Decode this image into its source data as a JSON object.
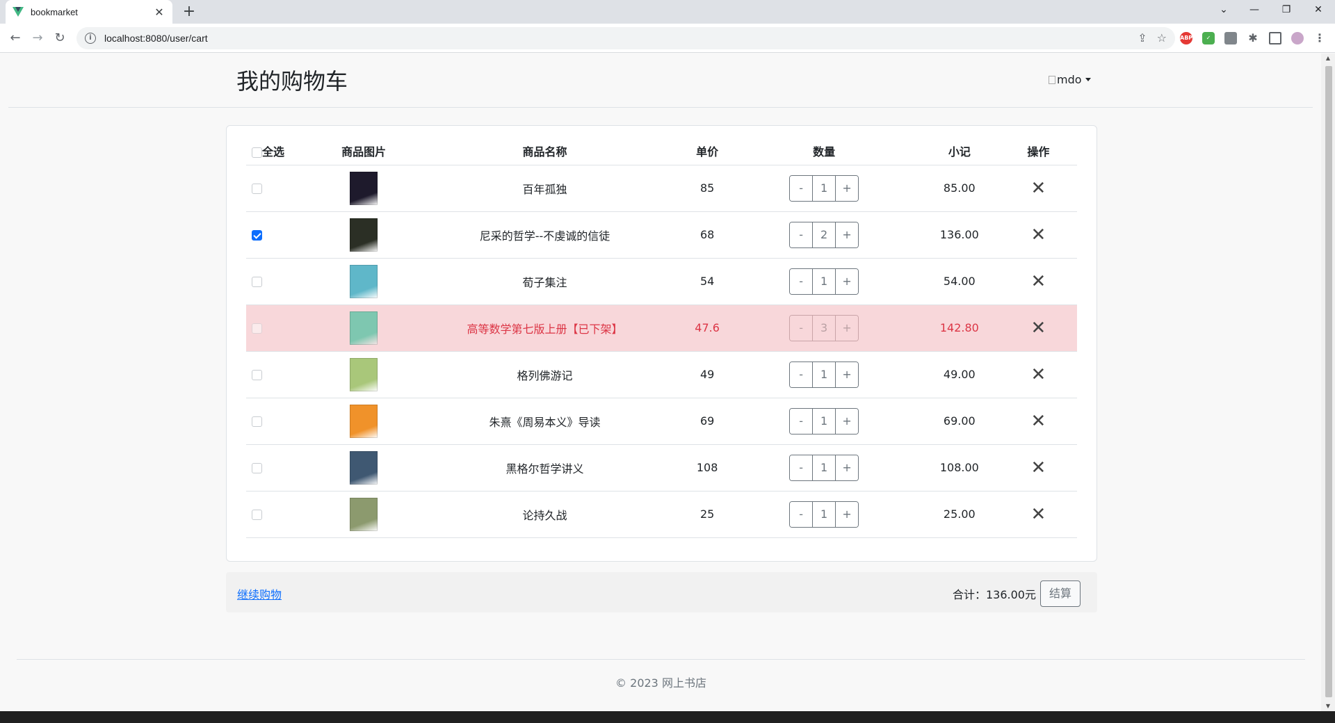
{
  "browser": {
    "tab_title": "bookmarket",
    "url": "localhost:8080/user/cart",
    "new_tab": "+",
    "tab_close": "✕"
  },
  "header": {
    "title": "我的购物车",
    "user_name": "mdo"
  },
  "table": {
    "headers": {
      "select_all": "全选",
      "image": "商品图片",
      "name": "商品名称",
      "price": "单价",
      "quantity": "数量",
      "subtotal": "小记",
      "action": "操作"
    },
    "rows": [
      {
        "checked": false,
        "disabled": false,
        "name": "百年孤独",
        "price": "85",
        "qty": "1",
        "subtotal": "85.00",
        "cover_color": "#1e1a2c"
      },
      {
        "checked": true,
        "disabled": false,
        "name": "尼采的哲学--不虔诚的信徒",
        "price": "68",
        "qty": "2",
        "subtotal": "136.00",
        "cover_color": "#2b2f25"
      },
      {
        "checked": false,
        "disabled": false,
        "name": "荀子集注",
        "price": "54",
        "qty": "1",
        "subtotal": "54.00",
        "cover_color": "#5fb7c9"
      },
      {
        "checked": false,
        "disabled": true,
        "name": "高等数学第七版上册【已下架】",
        "price": "47.6",
        "qty": "3",
        "subtotal": "142.80",
        "cover_color": "#7ec7b0"
      },
      {
        "checked": false,
        "disabled": false,
        "name": "格列佛游记",
        "price": "49",
        "qty": "1",
        "subtotal": "49.00",
        "cover_color": "#a9c77a"
      },
      {
        "checked": false,
        "disabled": false,
        "name": "朱熹《周易本义》导读",
        "price": "69",
        "qty": "1",
        "subtotal": "69.00",
        "cover_color": "#f0922a"
      },
      {
        "checked": false,
        "disabled": false,
        "name": "黑格尔哲学讲义",
        "price": "108",
        "qty": "1",
        "subtotal": "108.00",
        "cover_color": "#3f5872"
      },
      {
        "checked": false,
        "disabled": false,
        "name": "论持久战",
        "price": "25",
        "qty": "1",
        "subtotal": "25.00",
        "cover_color": "#8c9a6e"
      }
    ],
    "minus": "-",
    "plus": "+",
    "remove_glyph": "✕"
  },
  "summary": {
    "continue_shopping": "继续购物",
    "total_label": "合计：",
    "total_value": "136.00元",
    "checkout": "结算"
  },
  "footer": {
    "copyright": "© 2023 网上书店"
  },
  "colors": {
    "accent": "#0d6efd",
    "danger_bg": "#f8d7da",
    "danger_text": "#dc3545"
  }
}
